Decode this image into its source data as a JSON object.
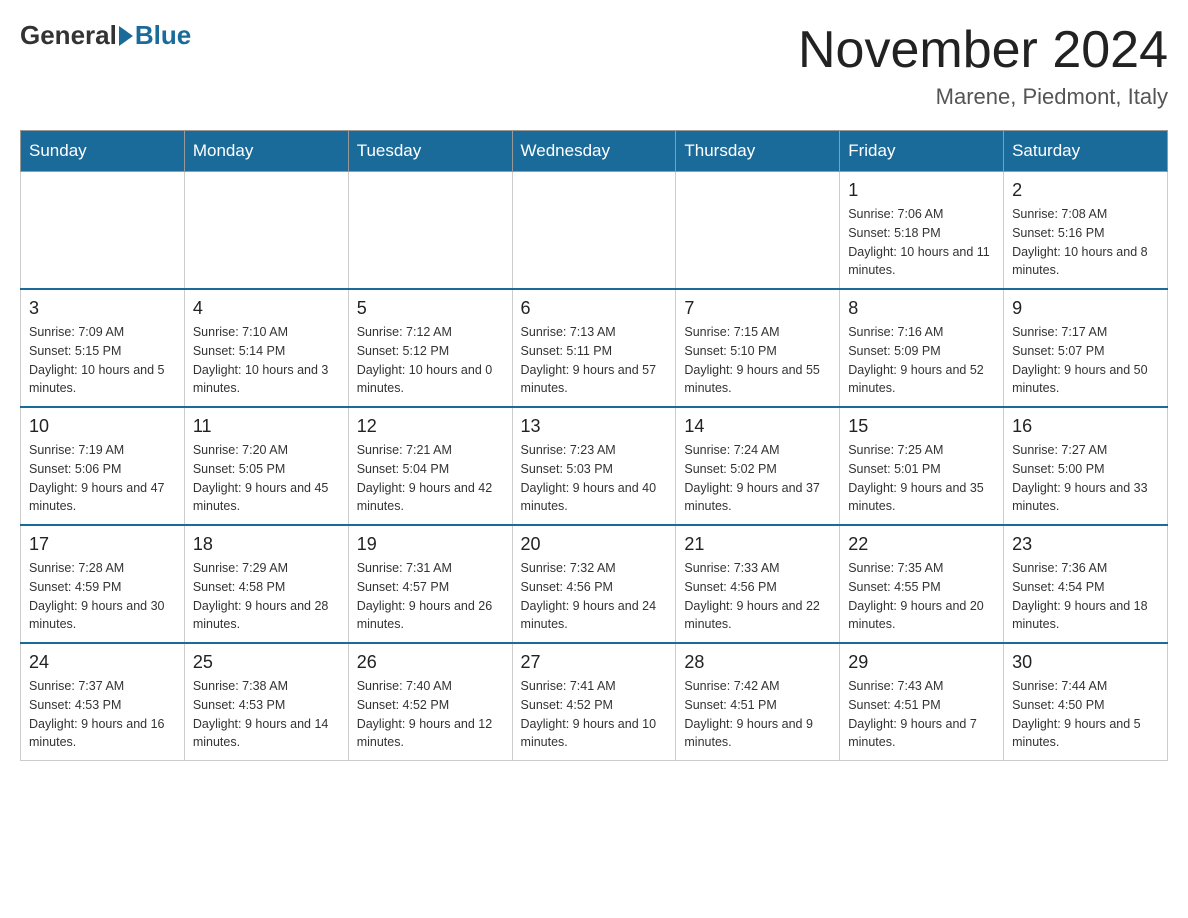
{
  "header": {
    "logo_general": "General",
    "logo_blue": "Blue",
    "month_title": "November 2024",
    "location": "Marene, Piedmont, Italy"
  },
  "days_of_week": [
    "Sunday",
    "Monday",
    "Tuesday",
    "Wednesday",
    "Thursday",
    "Friday",
    "Saturday"
  ],
  "weeks": [
    [
      {
        "day": "",
        "sunrise": "",
        "sunset": "",
        "daylight": ""
      },
      {
        "day": "",
        "sunrise": "",
        "sunset": "",
        "daylight": ""
      },
      {
        "day": "",
        "sunrise": "",
        "sunset": "",
        "daylight": ""
      },
      {
        "day": "",
        "sunrise": "",
        "sunset": "",
        "daylight": ""
      },
      {
        "day": "",
        "sunrise": "",
        "sunset": "",
        "daylight": ""
      },
      {
        "day": "1",
        "sunrise": "Sunrise: 7:06 AM",
        "sunset": "Sunset: 5:18 PM",
        "daylight": "Daylight: 10 hours and 11 minutes."
      },
      {
        "day": "2",
        "sunrise": "Sunrise: 7:08 AM",
        "sunset": "Sunset: 5:16 PM",
        "daylight": "Daylight: 10 hours and 8 minutes."
      }
    ],
    [
      {
        "day": "3",
        "sunrise": "Sunrise: 7:09 AM",
        "sunset": "Sunset: 5:15 PM",
        "daylight": "Daylight: 10 hours and 5 minutes."
      },
      {
        "day": "4",
        "sunrise": "Sunrise: 7:10 AM",
        "sunset": "Sunset: 5:14 PM",
        "daylight": "Daylight: 10 hours and 3 minutes."
      },
      {
        "day": "5",
        "sunrise": "Sunrise: 7:12 AM",
        "sunset": "Sunset: 5:12 PM",
        "daylight": "Daylight: 10 hours and 0 minutes."
      },
      {
        "day": "6",
        "sunrise": "Sunrise: 7:13 AM",
        "sunset": "Sunset: 5:11 PM",
        "daylight": "Daylight: 9 hours and 57 minutes."
      },
      {
        "day": "7",
        "sunrise": "Sunrise: 7:15 AM",
        "sunset": "Sunset: 5:10 PM",
        "daylight": "Daylight: 9 hours and 55 minutes."
      },
      {
        "day": "8",
        "sunrise": "Sunrise: 7:16 AM",
        "sunset": "Sunset: 5:09 PM",
        "daylight": "Daylight: 9 hours and 52 minutes."
      },
      {
        "day": "9",
        "sunrise": "Sunrise: 7:17 AM",
        "sunset": "Sunset: 5:07 PM",
        "daylight": "Daylight: 9 hours and 50 minutes."
      }
    ],
    [
      {
        "day": "10",
        "sunrise": "Sunrise: 7:19 AM",
        "sunset": "Sunset: 5:06 PM",
        "daylight": "Daylight: 9 hours and 47 minutes."
      },
      {
        "day": "11",
        "sunrise": "Sunrise: 7:20 AM",
        "sunset": "Sunset: 5:05 PM",
        "daylight": "Daylight: 9 hours and 45 minutes."
      },
      {
        "day": "12",
        "sunrise": "Sunrise: 7:21 AM",
        "sunset": "Sunset: 5:04 PM",
        "daylight": "Daylight: 9 hours and 42 minutes."
      },
      {
        "day": "13",
        "sunrise": "Sunrise: 7:23 AM",
        "sunset": "Sunset: 5:03 PM",
        "daylight": "Daylight: 9 hours and 40 minutes."
      },
      {
        "day": "14",
        "sunrise": "Sunrise: 7:24 AM",
        "sunset": "Sunset: 5:02 PM",
        "daylight": "Daylight: 9 hours and 37 minutes."
      },
      {
        "day": "15",
        "sunrise": "Sunrise: 7:25 AM",
        "sunset": "Sunset: 5:01 PM",
        "daylight": "Daylight: 9 hours and 35 minutes."
      },
      {
        "day": "16",
        "sunrise": "Sunrise: 7:27 AM",
        "sunset": "Sunset: 5:00 PM",
        "daylight": "Daylight: 9 hours and 33 minutes."
      }
    ],
    [
      {
        "day": "17",
        "sunrise": "Sunrise: 7:28 AM",
        "sunset": "Sunset: 4:59 PM",
        "daylight": "Daylight: 9 hours and 30 minutes."
      },
      {
        "day": "18",
        "sunrise": "Sunrise: 7:29 AM",
        "sunset": "Sunset: 4:58 PM",
        "daylight": "Daylight: 9 hours and 28 minutes."
      },
      {
        "day": "19",
        "sunrise": "Sunrise: 7:31 AM",
        "sunset": "Sunset: 4:57 PM",
        "daylight": "Daylight: 9 hours and 26 minutes."
      },
      {
        "day": "20",
        "sunrise": "Sunrise: 7:32 AM",
        "sunset": "Sunset: 4:56 PM",
        "daylight": "Daylight: 9 hours and 24 minutes."
      },
      {
        "day": "21",
        "sunrise": "Sunrise: 7:33 AM",
        "sunset": "Sunset: 4:56 PM",
        "daylight": "Daylight: 9 hours and 22 minutes."
      },
      {
        "day": "22",
        "sunrise": "Sunrise: 7:35 AM",
        "sunset": "Sunset: 4:55 PM",
        "daylight": "Daylight: 9 hours and 20 minutes."
      },
      {
        "day": "23",
        "sunrise": "Sunrise: 7:36 AM",
        "sunset": "Sunset: 4:54 PM",
        "daylight": "Daylight: 9 hours and 18 minutes."
      }
    ],
    [
      {
        "day": "24",
        "sunrise": "Sunrise: 7:37 AM",
        "sunset": "Sunset: 4:53 PM",
        "daylight": "Daylight: 9 hours and 16 minutes."
      },
      {
        "day": "25",
        "sunrise": "Sunrise: 7:38 AM",
        "sunset": "Sunset: 4:53 PM",
        "daylight": "Daylight: 9 hours and 14 minutes."
      },
      {
        "day": "26",
        "sunrise": "Sunrise: 7:40 AM",
        "sunset": "Sunset: 4:52 PM",
        "daylight": "Daylight: 9 hours and 12 minutes."
      },
      {
        "day": "27",
        "sunrise": "Sunrise: 7:41 AM",
        "sunset": "Sunset: 4:52 PM",
        "daylight": "Daylight: 9 hours and 10 minutes."
      },
      {
        "day": "28",
        "sunrise": "Sunrise: 7:42 AM",
        "sunset": "Sunset: 4:51 PM",
        "daylight": "Daylight: 9 hours and 9 minutes."
      },
      {
        "day": "29",
        "sunrise": "Sunrise: 7:43 AM",
        "sunset": "Sunset: 4:51 PM",
        "daylight": "Daylight: 9 hours and 7 minutes."
      },
      {
        "day": "30",
        "sunrise": "Sunrise: 7:44 AM",
        "sunset": "Sunset: 4:50 PM",
        "daylight": "Daylight: 9 hours and 5 minutes."
      }
    ]
  ]
}
